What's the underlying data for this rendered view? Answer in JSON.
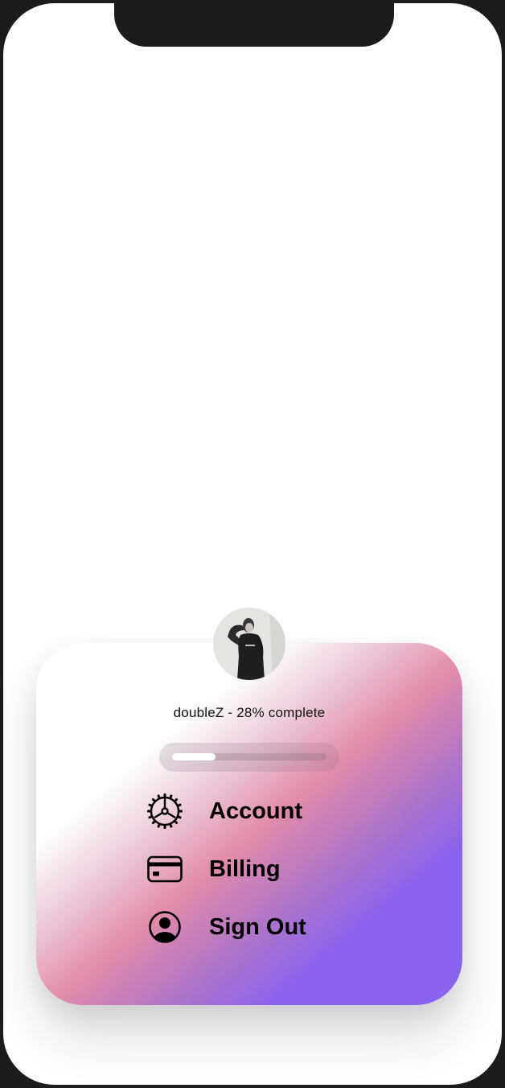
{
  "profile": {
    "status_text": "doubleZ - 28% complete",
    "progress_fraction": 0.28
  },
  "menu": {
    "items": [
      {
        "label": "Account",
        "icon": "gear-icon"
      },
      {
        "label": "Billing",
        "icon": "credit-card-icon"
      },
      {
        "label": "Sign Out",
        "icon": "person-circle-icon"
      }
    ]
  },
  "colors": {
    "gradient_start": "#ffffff",
    "gradient_pink": "#e38bab",
    "gradient_purple": "#8a63ee",
    "text": "#000000"
  }
}
